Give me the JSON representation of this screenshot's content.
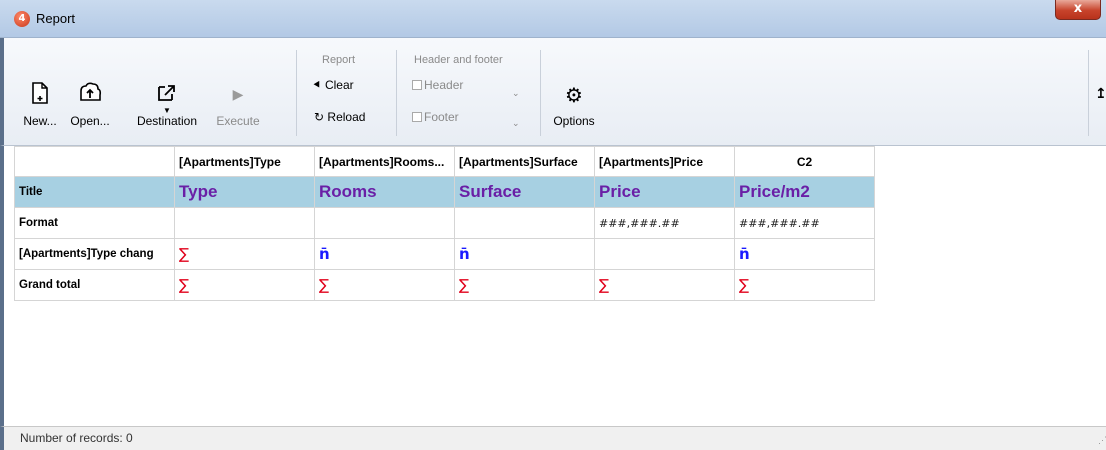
{
  "window": {
    "title": "Report",
    "close_glyph": "x",
    "app_icon_glyph": "4"
  },
  "toolbar": {
    "new_label": "New...",
    "open_label": "Open...",
    "destination_label": "Destination",
    "execute_label": "Execute",
    "report_group": "Report",
    "clear_label": "Clear",
    "reload_label": "Reload",
    "header_footer_group": "Header and footer",
    "header_label": "Header",
    "footer_label": "Footer",
    "options_label": "Options",
    "icons": {
      "new": "new-document-icon",
      "open": "open-icon",
      "destination": "destination-icon",
      "execute": "play-icon",
      "clear": "clear-icon",
      "reload": "reload-icon",
      "options": "gear-icon",
      "pin": "pin-icon"
    }
  },
  "report": {
    "columns": [
      "[Apartments]Type",
      "[Apartments]Rooms...",
      "[Apartments]Surface",
      "[Apartments]Price",
      "C2"
    ],
    "rows": {
      "title_label": "Title",
      "titles": [
        "Type",
        "Rooms",
        "Surface",
        "Price",
        "Price/m2"
      ],
      "format_label": "Format",
      "formats": [
        "",
        "",
        "",
        "###,###.##",
        "###,###.##"
      ],
      "break_label": "[Apartments]Type chang",
      "break_values": [
        "∑",
        "n̄",
        "n̄",
        "",
        "n̄"
      ],
      "total_label": "Grand total",
      "total_values": [
        "∑",
        "∑",
        "∑",
        "∑",
        "∑"
      ]
    }
  },
  "status": {
    "records_text": "Number of records: 0"
  },
  "colors": {
    "title_bg": "#a7d0e2",
    "title_text": "#6a1fa6",
    "sum": "#e0001a",
    "avg": "#1a1aff"
  }
}
